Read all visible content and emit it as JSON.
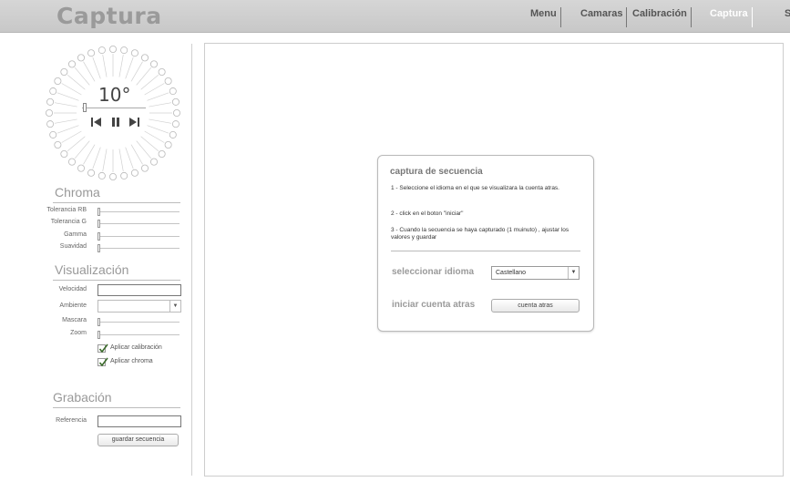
{
  "header": {
    "app_title": "Captura",
    "nav": [
      {
        "label": "Menu"
      },
      {
        "label": "Camaras"
      },
      {
        "label": "Calibración"
      },
      {
        "label": "Captura",
        "active": true
      },
      {
        "label": "S"
      }
    ]
  },
  "dial": {
    "value": "10°",
    "controls": [
      "skip-back",
      "pause",
      "skip-forward"
    ]
  },
  "chroma": {
    "title": "Chroma",
    "rows": [
      {
        "label": "Tolerancia RB",
        "value": 0
      },
      {
        "label": "Tolerancia G",
        "value": 0
      },
      {
        "label": "Gamma",
        "value": 0
      },
      {
        "label": "Suavidad",
        "value": 0
      }
    ]
  },
  "visualizacion": {
    "title": "Visualización",
    "velocidad_label": "Velocidad",
    "velocidad_value": "",
    "ambiente_label": "Ambiente",
    "ambiente_value": "",
    "mascara_label": "Mascara",
    "zoom_label": "Zoom",
    "check_calibracion": "Aplicar calibración",
    "check_chroma": "Aplicar chroma"
  },
  "grabacion": {
    "title": "Grabación",
    "referencia_label": "Referencia",
    "referencia_value": "",
    "save_button": "guardar secuencia"
  },
  "dialog": {
    "title": "captura de secuencia",
    "step1": "1 - Seleccione el idioma en el que se visualizara la cuenta atras.",
    "step2": "2 - click en el boton \"iniciar\"",
    "step3": "3 - Cuando la secuencia se haya capturado (1 muinuto) , ajustar los valores y guardar",
    "language_label": "seleccionar idioma",
    "language_value": "Castellano",
    "countdown_label": "iniciar cuenta atras",
    "countdown_button": "cuenta atras"
  },
  "colors": {
    "header_bg": "#cfcfcf",
    "title_gray": "#9a9a9a",
    "active_nav": "#ffffff"
  }
}
